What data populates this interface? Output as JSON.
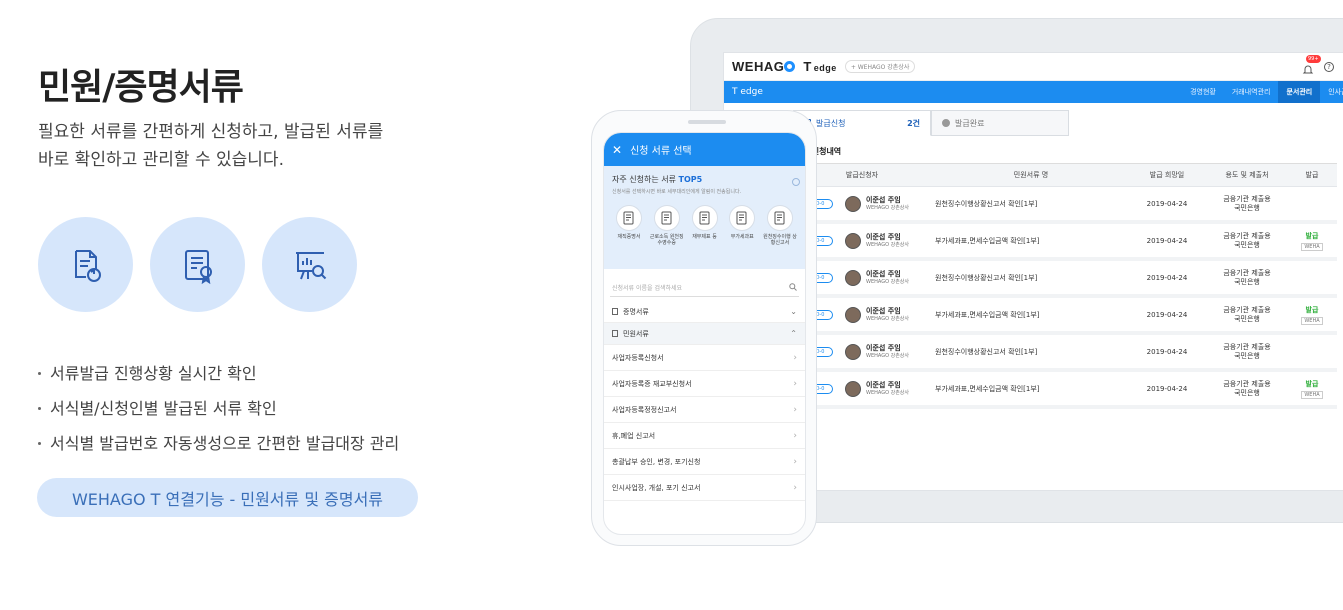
{
  "intro": {
    "title": "민원/증명서류",
    "desc_line1": "필요한 서류를 간편하게 신청하고, 발급된 서류를",
    "desc_line2": "바로 확인하고 관리할 수 있습니다.",
    "icons": [
      "document-refresh-icon",
      "certificate-icon",
      "presentation-search-icon"
    ],
    "bullets": [
      "서류발급 진행상황 실시간 확인",
      "서식별/신청인별 발급된 서류 확인",
      "서식별 발급번호 자동생성으로 간편한 발급대장 관리"
    ],
    "pill": "WEHAGO T 연결기능 - 민원서류 및 증명서류"
  },
  "laptop": {
    "logo_text": "WEHAG",
    "logo_t": "T",
    "logo_edge": "edge",
    "company_chip": "+ WEHAGO 강촌상사",
    "notif_badge": "99+",
    "help": "?",
    "nav_title": "T edge",
    "nav_menu": [
      "경영현황",
      "거래내역관리",
      "문서관리",
      "인사급여"
    ],
    "tabs": {
      "issue_request": "발급신청",
      "issue_request_count": "2건",
      "issue_done": "발급완료"
    },
    "section_title": "발급신청내역",
    "columns": [
      "발급신청자",
      "민원서류 명",
      "발급 희망일",
      "용도 및 제출처",
      "발급"
    ],
    "rows": [
      {
        "dday": "D-0",
        "name": "이준섭 주임",
        "company": "WEHAGO 강촌상사",
        "doc": "원천징수이행상황신고서 확인[1부]",
        "date": "2019-04-24",
        "purpose1": "금융기관 제출용",
        "purpose2": "국민은행",
        "status": "",
        "chip": ""
      },
      {
        "dday": "D-0",
        "name": "이준섭 주임",
        "company": "WEHAGO 강촌상사",
        "doc": "부가세과표,면세수입금액 확인[1부]",
        "date": "2019-04-24",
        "purpose1": "금융기관 제출용",
        "purpose2": "국민은행",
        "status": "발급",
        "chip": "WEHA"
      },
      {
        "dday": "D-0",
        "name": "이준섭 주임",
        "company": "WEHAGO 강촌상사",
        "doc": "원천징수이행상황신고서 확인[1부]",
        "date": "2019-04-24",
        "purpose1": "금융기관 제출용",
        "purpose2": "국민은행",
        "status": "",
        "chip": ""
      },
      {
        "dday": "D-0",
        "name": "이준섭 주임",
        "company": "WEHAGO 강촌상사",
        "doc": "부가세과표,면세수입금액 확인[1부]",
        "date": "2019-04-24",
        "purpose1": "금융기관 제출용",
        "purpose2": "국민은행",
        "status": "발급",
        "chip": "WEHA"
      },
      {
        "dday": "D-0",
        "name": "이준섭 주임",
        "company": "WEHAGO 강촌상사",
        "doc": "원천징수이행상황신고서 확인[1부]",
        "date": "2019-04-24",
        "purpose1": "금융기관 제출용",
        "purpose2": "국민은행",
        "status": "",
        "chip": ""
      },
      {
        "dday": "D-0",
        "name": "이준섭 주임",
        "company": "WEHAGO 강촌상사",
        "doc": "부가세과표,면세수입금액 확인[1부]",
        "date": "2019-04-24",
        "purpose1": "금융기관 제출용",
        "purpose2": "국민은행",
        "status": "발급",
        "chip": "WEHA"
      }
    ],
    "colors": {
      "brand_blue": "#1c8cf0",
      "issued_green": "#2fae3a"
    }
  },
  "phone": {
    "header_close": "✕",
    "header_title": "신청 서류 선택",
    "top5_title_prefix": "자주 신청하는 서류",
    "top5_title_accent": "TOP5",
    "top5_sub": "신청서를 선택하시면 바로 세무대리인에게 알림이 전송됩니다.",
    "top5_docs": [
      {
        "label": "재직증명서",
        "icon": "document-icon"
      },
      {
        "label": "근로소득 원천징수영수증",
        "icon": "document-stamp-icon"
      },
      {
        "label": "재무제표 등",
        "icon": "document-icon"
      },
      {
        "label": "부가세과표",
        "icon": "document-stamp-icon"
      },
      {
        "label": "원천징수이행 상황신고서",
        "icon": "document-stamp-icon"
      }
    ],
    "search_placeholder": "신청서류 이름을 검색하세요",
    "accordion": [
      {
        "label": "증명서류",
        "chev": "⌄"
      },
      {
        "label": "민원서류",
        "chev": "⌃"
      }
    ],
    "items": [
      "사업자등록신청서",
      "사업자등록증 재교부신청서",
      "사업자등록정정신고서",
      "휴,폐업 신고서",
      "총괄납부 승인, 변경, 포기신청",
      "인시사업장, 개설, 포기 신고서"
    ]
  }
}
